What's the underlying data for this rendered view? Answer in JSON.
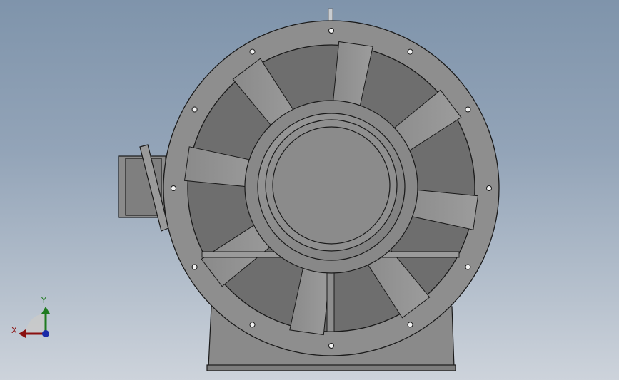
{
  "viewport": {
    "background_top": "#7f94ab",
    "background_bottom": "#cdd3db"
  },
  "model": {
    "fill_color": "#8c8c8c",
    "edge_color": "#1a1a1a",
    "blade_count": 8
  },
  "triad": {
    "x_label": "X",
    "y_label": "Y",
    "x_color": "#8a1010",
    "y_color": "#1f7a1f",
    "z_color": "#1a2aa8"
  }
}
